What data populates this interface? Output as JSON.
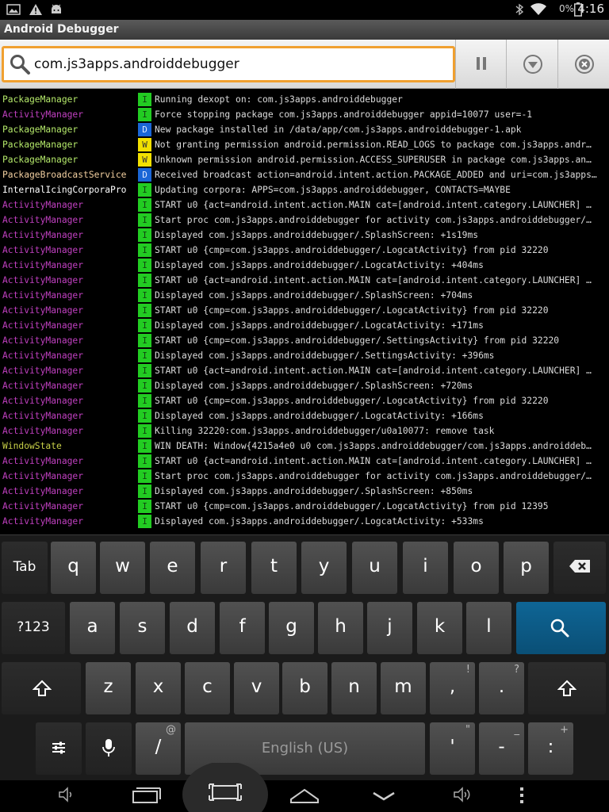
{
  "status_bar": {
    "battery_percent": "0%",
    "time": "4:16",
    "left_icons": [
      "picture-icon",
      "warning-icon",
      "android-icon"
    ],
    "right_icons": [
      "bluetooth-icon",
      "wifi-icon",
      "battery-icon"
    ]
  },
  "app": {
    "title": "Android Debugger"
  },
  "search": {
    "value": "com.js3apps.androiddebugger"
  },
  "toolbar": {
    "buttons": [
      "pause-icon",
      "dropdown-icon",
      "clear-icon"
    ]
  },
  "colors": {
    "PackageManager": "#b4e86a",
    "ActivityManager": "#c040c0",
    "PackageBroadcastService": "#f2cfa0",
    "InternalIcingCorporaPro": "#ffffff",
    "WindowState": "#c8d048"
  },
  "log": [
    {
      "tag": "PackageManager",
      "level": "I",
      "msg": "Running dexopt on: com.js3apps.androiddebugger"
    },
    {
      "tag": "ActivityManager",
      "level": "I",
      "msg": "Force stopping package com.js3apps.androiddebugger appid=10077 user=-1"
    },
    {
      "tag": "PackageManager",
      "level": "D",
      "msg": "New package installed in /data/app/com.js3apps.androiddebugger-1.apk"
    },
    {
      "tag": "PackageManager",
      "level": "W",
      "msg": "Not granting permission android.permission.READ_LOGS to package com.js3apps.andr…"
    },
    {
      "tag": "PackageManager",
      "level": "W",
      "msg": "Unknown permission android.permission.ACCESS_SUPERUSER in package com.js3apps.an…"
    },
    {
      "tag": "PackageBroadcastService",
      "level": "D",
      "msg": "Received broadcast action=android.intent.action.PACKAGE_ADDED and uri=com.js3apps…"
    },
    {
      "tag": "InternalIcingCorporaPro",
      "level": "I",
      "msg": "Updating corpora: APPS=com.js3apps.androiddebugger, CONTACTS=MAYBE"
    },
    {
      "tag": "ActivityManager",
      "level": "I",
      "msg": "START u0 {act=android.intent.action.MAIN cat=[android.intent.category.LAUNCHER] …"
    },
    {
      "tag": "ActivityManager",
      "level": "I",
      "msg": "Start proc com.js3apps.androiddebugger for activity com.js3apps.androiddebugger/…"
    },
    {
      "tag": "ActivityManager",
      "level": "I",
      "msg": "Displayed com.js3apps.androiddebugger/.SplashScreen: +1s19ms"
    },
    {
      "tag": "ActivityManager",
      "level": "I",
      "msg": "START u0 {cmp=com.js3apps.androiddebugger/.LogcatActivity} from pid 32220"
    },
    {
      "tag": "ActivityManager",
      "level": "I",
      "msg": "Displayed com.js3apps.androiddebugger/.LogcatActivity: +404ms"
    },
    {
      "tag": "ActivityManager",
      "level": "I",
      "msg": "START u0 {act=android.intent.action.MAIN cat=[android.intent.category.LAUNCHER] …"
    },
    {
      "tag": "ActivityManager",
      "level": "I",
      "msg": "Displayed com.js3apps.androiddebugger/.SplashScreen: +704ms"
    },
    {
      "tag": "ActivityManager",
      "level": "I",
      "msg": "START u0 {cmp=com.js3apps.androiddebugger/.LogcatActivity} from pid 32220"
    },
    {
      "tag": "ActivityManager",
      "level": "I",
      "msg": "Displayed com.js3apps.androiddebugger/.LogcatActivity: +171ms"
    },
    {
      "tag": "ActivityManager",
      "level": "I",
      "msg": "START u0 {cmp=com.js3apps.androiddebugger/.SettingsActivity} from pid 32220"
    },
    {
      "tag": "ActivityManager",
      "level": "I",
      "msg": "Displayed com.js3apps.androiddebugger/.SettingsActivity: +396ms"
    },
    {
      "tag": "ActivityManager",
      "level": "I",
      "msg": "START u0 {act=android.intent.action.MAIN cat=[android.intent.category.LAUNCHER] …"
    },
    {
      "tag": "ActivityManager",
      "level": "I",
      "msg": "Displayed com.js3apps.androiddebugger/.SplashScreen: +720ms"
    },
    {
      "tag": "ActivityManager",
      "level": "I",
      "msg": "START u0 {cmp=com.js3apps.androiddebugger/.LogcatActivity} from pid 32220"
    },
    {
      "tag": "ActivityManager",
      "level": "I",
      "msg": "Displayed com.js3apps.androiddebugger/.LogcatActivity: +166ms"
    },
    {
      "tag": "ActivityManager",
      "level": "I",
      "msg": "Killing 32220:com.js3apps.androiddebugger/u0a10077: remove task"
    },
    {
      "tag": "WindowState",
      "level": "I",
      "msg": "WIN DEATH: Window{4215a4e0 u0 com.js3apps.androiddebugger/com.js3apps.androiddeb…"
    },
    {
      "tag": "ActivityManager",
      "level": "I",
      "msg": "START u0 {act=android.intent.action.MAIN cat=[android.intent.category.LAUNCHER] …"
    },
    {
      "tag": "ActivityManager",
      "level": "I",
      "msg": "Start proc com.js3apps.androiddebugger for activity com.js3apps.androiddebugger/…"
    },
    {
      "tag": "ActivityManager",
      "level": "I",
      "msg": "Displayed com.js3apps.androiddebugger/.SplashScreen: +850ms"
    },
    {
      "tag": "ActivityManager",
      "level": "I",
      "msg": "START u0 {cmp=com.js3apps.androiddebugger/.LogcatActivity} from pid 12395"
    },
    {
      "tag": "ActivityManager",
      "level": "I",
      "msg": "Displayed com.js3apps.androiddebugger/.LogcatActivity: +533ms"
    }
  ],
  "keyboard": {
    "row1": [
      "Tab",
      "q",
      "w",
      "e",
      "r",
      "t",
      "y",
      "u",
      "i",
      "o",
      "p"
    ],
    "row2": [
      "?123",
      "a",
      "s",
      "d",
      "f",
      "g",
      "h",
      "j",
      "k",
      "l"
    ],
    "row3": [
      "z",
      "x",
      "c",
      "v",
      "b",
      "n",
      "m",
      ",",
      "."
    ],
    "row3_hints": [
      "!",
      "?"
    ],
    "row4": {
      "slash": "/",
      "slash_hint": "@",
      "space": "English (US)",
      "apostrophe": "'",
      "apostrophe_hint": "\"",
      "dash": "-",
      "dash_hint": "_",
      "colon": ":",
      "colon_hint": "+"
    }
  },
  "navbar": [
    "volume-down-icon",
    "back-icon",
    "home-icon",
    "recent-apps-icon",
    "screenshot-icon",
    "hide-keyboard-icon",
    "volume-up-icon",
    "menu-icon"
  ]
}
